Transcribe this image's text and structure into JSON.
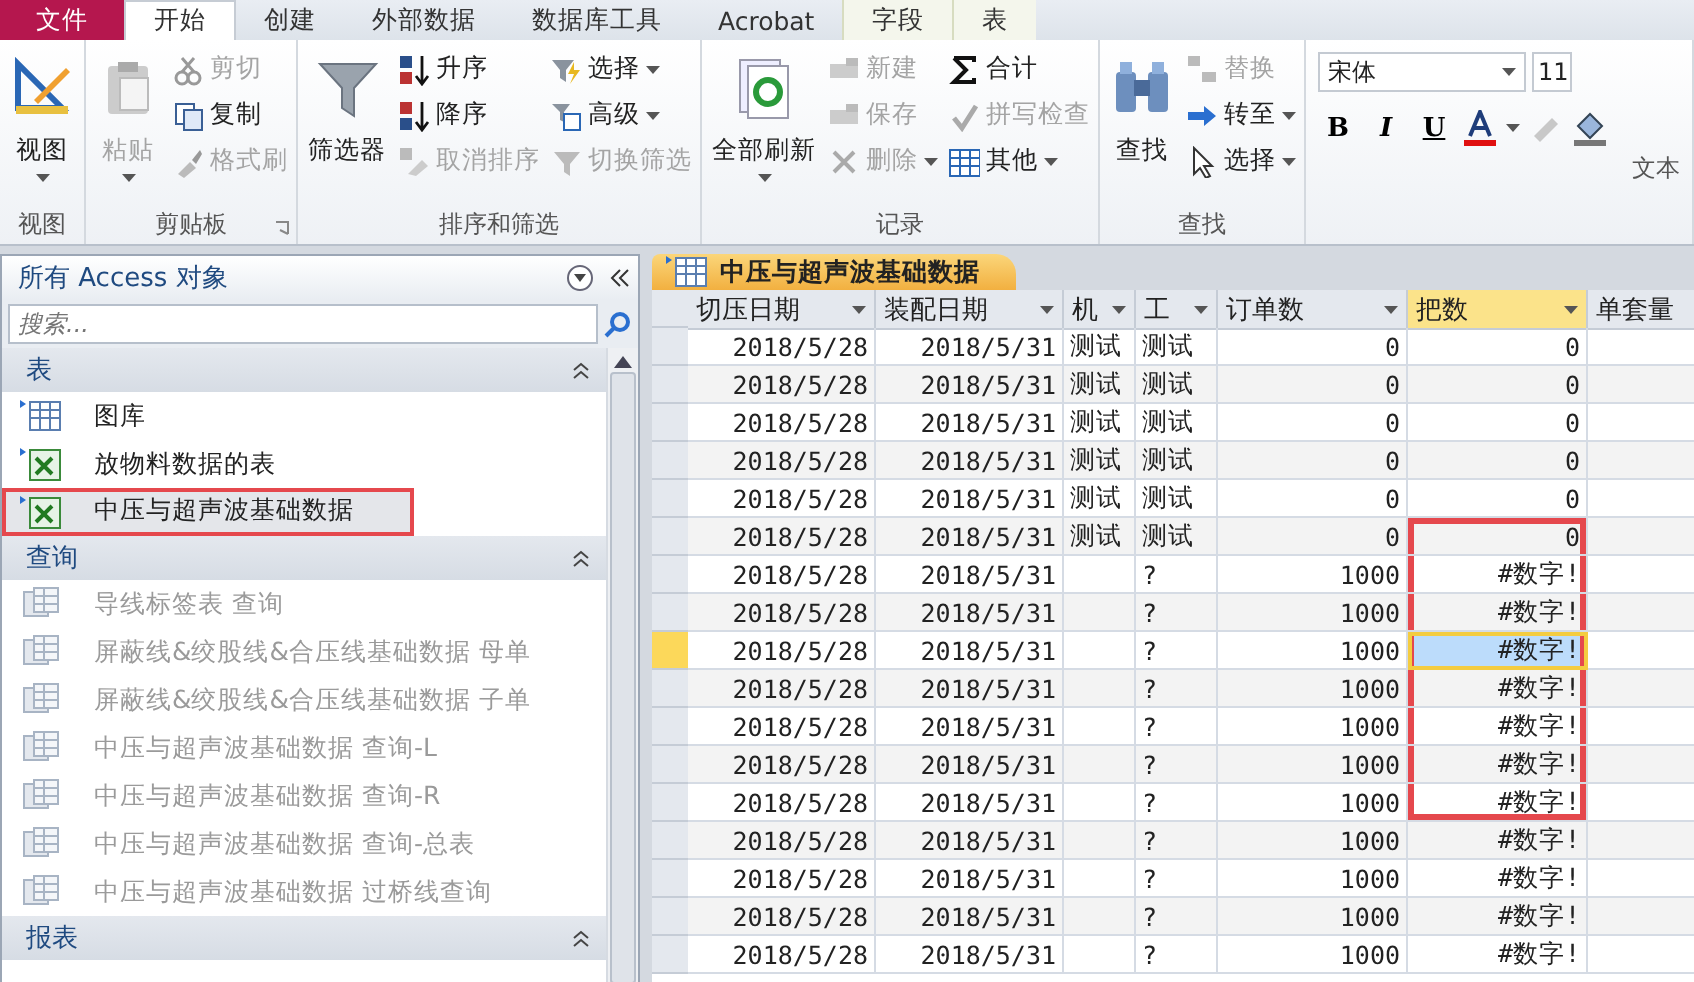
{
  "ribbon": {
    "tabs": [
      {
        "label": "文件",
        "kind": "file",
        "selected": false
      },
      {
        "label": "开始",
        "kind": "normal",
        "selected": true
      },
      {
        "label": "创建",
        "kind": "normal",
        "selected": false
      },
      {
        "label": "外部数据",
        "kind": "normal",
        "selected": false
      },
      {
        "label": "数据库工具",
        "kind": "normal",
        "selected": false
      },
      {
        "label": "Acrobat",
        "kind": "normal",
        "selected": false
      },
      {
        "label": "字段",
        "kind": "context",
        "selected": false
      },
      {
        "label": "表",
        "kind": "context",
        "selected": false
      }
    ],
    "groups": [
      {
        "label": "视图",
        "kind": "buttons",
        "items": [
          {
            "label": "视图",
            "kind": "large",
            "disabled": false,
            "dropdown": true
          }
        ]
      },
      {
        "label": "剪贴板",
        "kind": "buttons",
        "launcher": true,
        "items": [
          {
            "label": "粘贴",
            "kind": "large",
            "disabled": true,
            "dropdown": true
          },
          {
            "label": "剪切",
            "kind": "small",
            "disabled": true,
            "dropdown": false
          },
          {
            "label": "复制",
            "kind": "small",
            "disabled": false,
            "dropdown": false
          },
          {
            "label": "格式刷",
            "kind": "small",
            "disabled": true,
            "dropdown": false
          }
        ]
      },
      {
        "label": "排序和筛选",
        "kind": "buttons",
        "items": [
          {
            "label": "筛选器",
            "kind": "large",
            "disabled": false,
            "dropdown": false
          },
          {
            "label": "升序",
            "kind": "small",
            "disabled": false,
            "dropdown": false
          },
          {
            "label": "降序",
            "kind": "small",
            "disabled": false,
            "dropdown": false
          },
          {
            "label": "取消排序",
            "kind": "small",
            "disabled": true,
            "dropdown": false
          },
          {
            "label": "选择",
            "kind": "small",
            "disabled": false,
            "dropdown": true
          },
          {
            "label": "高级",
            "kind": "small",
            "disabled": false,
            "dropdown": true
          },
          {
            "label": "切换筛选",
            "kind": "small",
            "disabled": true,
            "dropdown": false
          }
        ]
      },
      {
        "label": "记录",
        "kind": "buttons",
        "items": [
          {
            "label": "全部刷新",
            "kind": "large",
            "disabled": false,
            "dropdown": true
          },
          {
            "label": "新建",
            "kind": "small",
            "disabled": true,
            "dropdown": false
          },
          {
            "label": "保存",
            "kind": "small",
            "disabled": true,
            "dropdown": false
          },
          {
            "label": "删除",
            "kind": "small",
            "disabled": true,
            "dropdown": true
          },
          {
            "label": "合计",
            "kind": "small",
            "disabled": false,
            "dropdown": false
          },
          {
            "label": "拼写检查",
            "kind": "small",
            "disabled": true,
            "dropdown": false
          },
          {
            "label": "其他",
            "kind": "small",
            "disabled": false,
            "dropdown": true
          }
        ]
      },
      {
        "label": "查找",
        "kind": "buttons",
        "items": [
          {
            "label": "查找",
            "kind": "large",
            "disabled": false,
            "dropdown": false
          },
          {
            "label": "替换",
            "kind": "small",
            "disabled": true,
            "dropdown": false
          },
          {
            "label": "转至",
            "kind": "small",
            "disabled": false,
            "dropdown": true
          },
          {
            "label": "选择",
            "kind": "small",
            "disabled": false,
            "dropdown": true
          }
        ]
      },
      {
        "label": "文本",
        "kind": "format",
        "font": "宋体",
        "size": "11",
        "styles": [
          "B",
          "I",
          "U"
        ]
      }
    ]
  },
  "nav": {
    "title": "所有 Access 对象",
    "search_placeholder": "搜索...",
    "sections": [
      {
        "title": "表",
        "items": [
          {
            "label": "图库",
            "kind": "table",
            "selected": false,
            "highlighted": false,
            "disabled": false
          },
          {
            "label": "放物料数据的表",
            "kind": "excel",
            "selected": false,
            "highlighted": false,
            "disabled": false
          },
          {
            "label": "中压与超声波基础数据",
            "kind": "excel",
            "selected": true,
            "highlighted": true,
            "disabled": false
          }
        ]
      },
      {
        "title": "查询",
        "items": [
          {
            "label": "导线标签表 查询",
            "kind": "query",
            "selected": false,
            "highlighted": false,
            "disabled": true
          },
          {
            "label": "屏蔽线&绞股线&合压线基础数据 母单",
            "kind": "query",
            "selected": false,
            "highlighted": false,
            "disabled": true
          },
          {
            "label": "屏蔽线&绞股线&合压线基础数据 子单",
            "kind": "query",
            "selected": false,
            "highlighted": false,
            "disabled": true
          },
          {
            "label": "中压与超声波基础数据 查询-L",
            "kind": "query",
            "selected": false,
            "highlighted": false,
            "disabled": true
          },
          {
            "label": "中压与超声波基础数据 查询-R",
            "kind": "query",
            "selected": false,
            "highlighted": false,
            "disabled": true
          },
          {
            "label": "中压与超声波基础数据 查询-总表",
            "kind": "query",
            "selected": false,
            "highlighted": false,
            "disabled": true
          },
          {
            "label": "中压与超声波基础数据 过桥线查询",
            "kind": "query",
            "selected": false,
            "highlighted": false,
            "disabled": true
          }
        ]
      },
      {
        "title": "报表"
      }
    ]
  },
  "document": {
    "tab": "中压与超声波基础数据",
    "columns": [
      {
        "label": "切压日期",
        "dropdown": true,
        "selected": false
      },
      {
        "label": "装配日期",
        "dropdown": true,
        "selected": false
      },
      {
        "label": "机",
        "dropdown": true,
        "selected": false
      },
      {
        "label": "工",
        "dropdown": true,
        "selected": false
      },
      {
        "label": "订单数",
        "dropdown": true,
        "selected": false
      },
      {
        "label": "把数",
        "dropdown": true,
        "selected": true
      },
      {
        "label": "单套量",
        "dropdown": false,
        "selected": false
      }
    ],
    "rows": [
      {
        "cells": [
          "2018/5/28",
          "2018/5/31",
          "测试",
          "测试",
          "0",
          "0"
        ],
        "selected": false,
        "annotated": false
      },
      {
        "cells": [
          "2018/5/28",
          "2018/5/31",
          "测试",
          "测试",
          "0",
          "0"
        ],
        "selected": false,
        "annotated": false
      },
      {
        "cells": [
          "2018/5/28",
          "2018/5/31",
          "测试",
          "测试",
          "0",
          "0"
        ],
        "selected": false,
        "annotated": false
      },
      {
        "cells": [
          "2018/5/28",
          "2018/5/31",
          "测试",
          "测试",
          "0",
          "0"
        ],
        "selected": false,
        "annotated": false
      },
      {
        "cells": [
          "2018/5/28",
          "2018/5/31",
          "测试",
          "测试",
          "0",
          "0"
        ],
        "selected": false,
        "annotated": false
      },
      {
        "cells": [
          "2018/5/28",
          "2018/5/31",
          "测试",
          "测试",
          "0",
          "0"
        ],
        "selected": false,
        "annotated": true
      },
      {
        "cells": [
          "2018/5/28",
          "2018/5/31",
          "",
          "?",
          "1000",
          "#数字!"
        ],
        "selected": false,
        "annotated": true
      },
      {
        "cells": [
          "2018/5/28",
          "2018/5/31",
          "",
          "?",
          "1000",
          "#数字!"
        ],
        "selected": false,
        "annotated": true
      },
      {
        "cells": [
          "2018/5/28",
          "2018/5/31",
          "",
          "?",
          "1000",
          "#数字!"
        ],
        "selected": true,
        "annotated": true
      },
      {
        "cells": [
          "2018/5/28",
          "2018/5/31",
          "",
          "?",
          "1000",
          "#数字!"
        ],
        "selected": false,
        "annotated": true
      },
      {
        "cells": [
          "2018/5/28",
          "2018/5/31",
          "",
          "?",
          "1000",
          "#数字!"
        ],
        "selected": false,
        "annotated": true
      },
      {
        "cells": [
          "2018/5/28",
          "2018/5/31",
          "",
          "?",
          "1000",
          "#数字!"
        ],
        "selected": false,
        "annotated": true
      },
      {
        "cells": [
          "2018/5/28",
          "2018/5/31",
          "",
          "?",
          "1000",
          "#数字!"
        ],
        "selected": false,
        "annotated": true
      },
      {
        "cells": [
          "2018/5/28",
          "2018/5/31",
          "",
          "?",
          "1000",
          "#数字!"
        ],
        "selected": false,
        "annotated": false
      },
      {
        "cells": [
          "2018/5/28",
          "2018/5/31",
          "",
          "?",
          "1000",
          "#数字!"
        ],
        "selected": false,
        "annotated": false
      },
      {
        "cells": [
          "2018/5/28",
          "2018/5/31",
          "",
          "?",
          "1000",
          "#数字!"
        ],
        "selected": false,
        "annotated": false
      },
      {
        "cells": [
          "2018/5/28",
          "2018/5/31",
          "",
          "?",
          "1000",
          "#数字!"
        ],
        "selected": false,
        "annotated": false
      }
    ]
  }
}
